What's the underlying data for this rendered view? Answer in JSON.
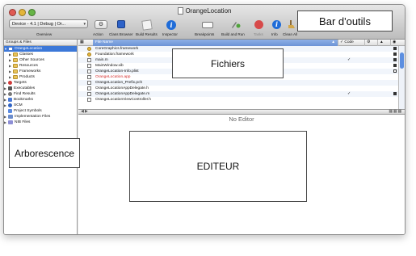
{
  "window": {
    "title": "OrangeLocation"
  },
  "toolbar": {
    "scheme_value": "Device - 4.1 | Debug | Or...",
    "overview_label": "Overview",
    "action_label": "Action",
    "class_browser_label": "Class Browser",
    "build_results_label": "Build Results",
    "inspector_label": "Inspector",
    "breakpoints_label": "Breakpoints",
    "build_and_run_label": "Build and Run",
    "tasks_label": "Tasks",
    "info_label": "Info",
    "clean_all_label": "Clean All"
  },
  "annotations": {
    "toolbar": "Bar d'outils",
    "files": "Fichiers",
    "tree": "Arborescence",
    "editor": "EDITEUR"
  },
  "sidebar": {
    "header": "Groups & Files",
    "items": [
      {
        "label": "OrangeLocation",
        "icon": "project-icon"
      },
      {
        "label": "Classes",
        "icon": "folder-icon"
      },
      {
        "label": "Other Sources",
        "icon": "folder-icon"
      },
      {
        "label": "Resources",
        "icon": "folder-icon"
      },
      {
        "label": "Frameworks",
        "icon": "folder-icon"
      },
      {
        "label": "Products",
        "icon": "folder-icon"
      },
      {
        "label": "Targets",
        "icon": "target-icon"
      },
      {
        "label": "Executables",
        "icon": "executable-icon"
      },
      {
        "label": "Find Results",
        "icon": "find-icon"
      },
      {
        "label": "Bookmarks",
        "icon": "bookmark-icon"
      },
      {
        "label": "SCM",
        "icon": "scm-icon"
      },
      {
        "label": "Project Symbols",
        "icon": "symbols-icon"
      },
      {
        "label": "Implementation Files",
        "icon": "implementation-files-icon"
      },
      {
        "label": "NIB Files",
        "icon": "nib-files-icon"
      }
    ]
  },
  "file_list": {
    "columns": {
      "name": "File Name",
      "code": "Code"
    },
    "rows": [
      {
        "name": "CoreGraphics.framework",
        "code_checked": false
      },
      {
        "name": "Foundation.framework",
        "code_checked": false
      },
      {
        "name": "main.m",
        "code_checked": true
      },
      {
        "name": "MainWindow.xib",
        "code_checked": false
      },
      {
        "name": "OrangeLocation-Info.plist",
        "code_checked": false
      },
      {
        "name": "OrangeLocation.app",
        "code_checked": false,
        "missing": true
      },
      {
        "name": "OrangeLocation_Prefix.pch",
        "code_checked": false
      },
      {
        "name": "OrangeLocationAppDelegate.h",
        "code_checked": false
      },
      {
        "name": "OrangeLocationAppDelegate.m",
        "code_checked": true
      },
      {
        "name": "OrangeLocationViewController.h",
        "code_checked": false
      }
    ]
  },
  "editor": {
    "placeholder": "No Editor"
  },
  "colors": {
    "selection": "#3c78d8",
    "missing_file": "#d42c2c"
  }
}
